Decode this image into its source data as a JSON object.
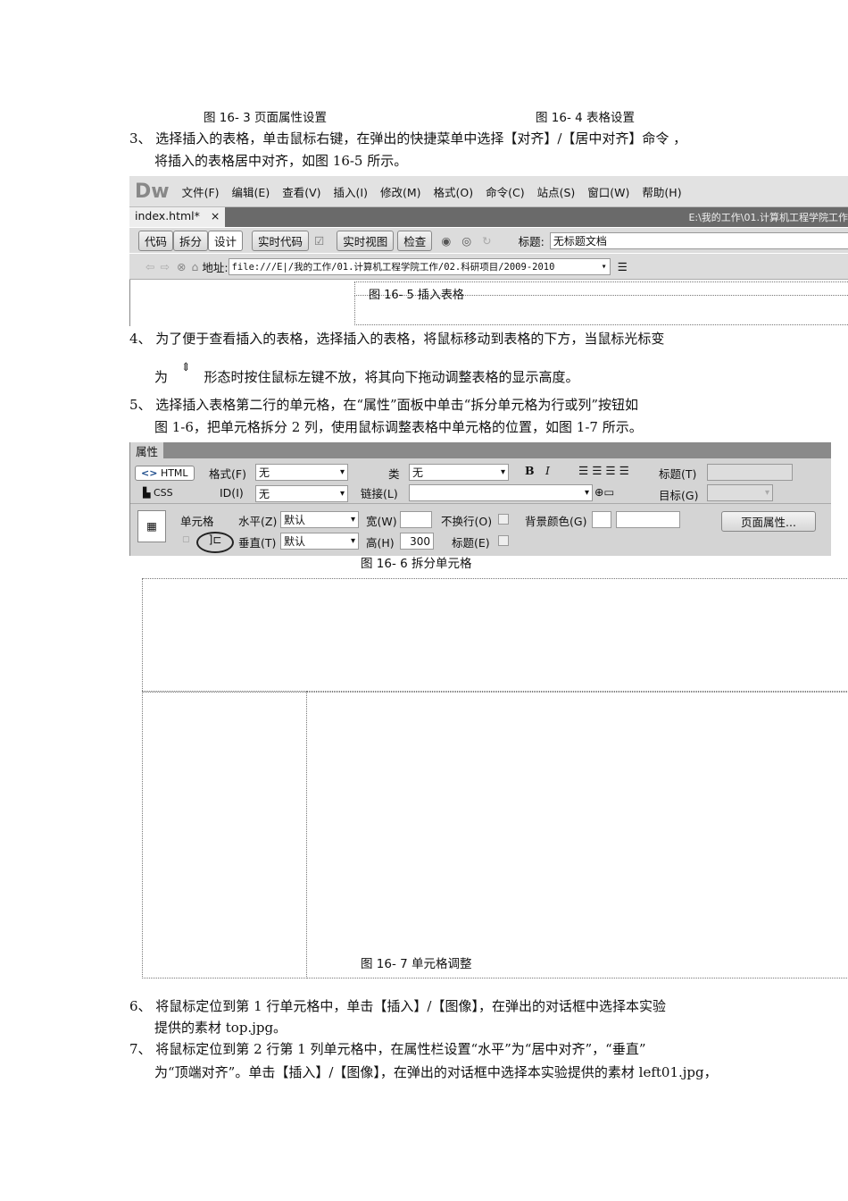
{
  "captions": {
    "fig3": "图 16- 3 页面属性设置",
    "fig4": "图 16- 4 表格设置",
    "fig5": "图 16- 5  插入表格",
    "fig6": "图 16- 6  拆分单元格",
    "fig7": "图 16- 7  单元格调整"
  },
  "paragraphs": {
    "p3a": "3、 选择插入的表格，单击鼠标右键，在弹出的快捷菜单中选择【对齐】/【居中对齐】命令 ，",
    "p3b": "将插入的表格居中对齐，如图 16-5 所示。",
    "p4a": "4、 为了便于查看插入的表格，选择插入的表格，将鼠标移动到表格的下方，当鼠标光标变",
    "p4b_pre": "为",
    "p4b_post": "形态时按住鼠标左键不放，将其向下拖动调整表格的显示高度。",
    "p5a": "5、 选择插入表格第二行的单元格，在“属性”面板中单击“拆分单元格为行或列”按钮如",
    "p5b": "图 1-6，把单元格拆分 2 列，使用鼠标调整表格中单元格的位置，如图 1-7 所示。",
    "p6a": "6、 将鼠标定位到第 1 行单元格中，单击【插入】/【图像】，在弹出的对话框中选择本实验",
    "p6b": "提供的素材 top.jpg。",
    "p7a": "7、 将鼠标定位到第 2 行第 1 列单元格中，在属性栏设置“水平”为“居中对齐”，“垂直”",
    "p7b": "为“顶端对齐”。单击【插入】/【图像】，在弹出的对话框中选择本实验提供的素材 left01.jpg，"
  },
  "dw": {
    "logo": "Dw",
    "menu": [
      "文件(F)",
      "编辑(E)",
      "查看(V)",
      "插入(I)",
      "修改(M)",
      "格式(O)",
      "命令(C)",
      "站点(S)",
      "窗口(W)",
      "帮助(H)"
    ],
    "tab": "index.html*",
    "tab_close": "×",
    "path": "E:\\我的工作\\01.计算机工程学院工作",
    "views": [
      "代码",
      "拆分",
      "设计"
    ],
    "live_code": "实时代码",
    "live_view": "实时视图",
    "inspect": "检查",
    "title_label": "标题:",
    "title_value": "无标题文档",
    "address_label": "地址:",
    "address_value": "file:///E|/我的工作/01.计算机工程学院工作/02.科研项目/2009-2010"
  },
  "props": {
    "header": "属性",
    "html": "HTML",
    "css": "CSS",
    "format_label": "格式(F)",
    "format_value": "无",
    "class_label": "类",
    "class_value": "无",
    "id_label": "ID(I)",
    "id_value": "无",
    "link_label": "链接(L)",
    "title_label": "标题(T)",
    "target_label": "目标(G)",
    "cell_label": "单元格",
    "horz_label": "水平(Z)",
    "horz_value": "默认",
    "vert_label": "垂直(T)",
    "vert_value": "默认",
    "width_label": "宽(W)",
    "height_label": "高(H)",
    "height_value": "300",
    "nowrap_label": "不换行(O)",
    "header_label": "标题(E)",
    "bg_label": "背景颜色(G)",
    "page_props": "页面属性..."
  }
}
